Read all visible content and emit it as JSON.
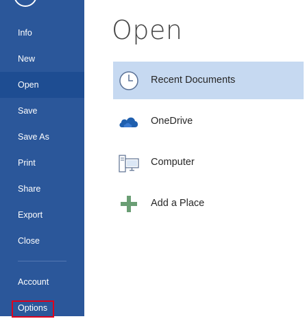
{
  "sidebar": {
    "items": [
      {
        "label": "Info"
      },
      {
        "label": "New"
      },
      {
        "label": "Open"
      },
      {
        "label": "Save"
      },
      {
        "label": "Save As"
      },
      {
        "label": "Print"
      },
      {
        "label": "Share"
      },
      {
        "label": "Export"
      },
      {
        "label": "Close"
      },
      {
        "label": "Account"
      },
      {
        "label": "Options"
      }
    ],
    "active_item": "Open",
    "highlighted_item": "Options"
  },
  "main": {
    "title": "Open",
    "places": [
      {
        "label": "Recent Documents",
        "icon": "clock-icon"
      },
      {
        "label": "OneDrive",
        "icon": "cloud-icon"
      },
      {
        "label": "Computer",
        "icon": "computer-icon"
      },
      {
        "label": "Add a Place",
        "icon": "plus-icon"
      }
    ],
    "selected_place": "Recent Documents"
  },
  "colors": {
    "sidebar_bg": "#2b579a",
    "sidebar_active": "#1e4d92",
    "selected_place_bg": "#c6d9f1",
    "highlight_border": "#e0001b",
    "onedrive_blue": "#1f5fae",
    "add_place_green": "#6a9e74"
  }
}
